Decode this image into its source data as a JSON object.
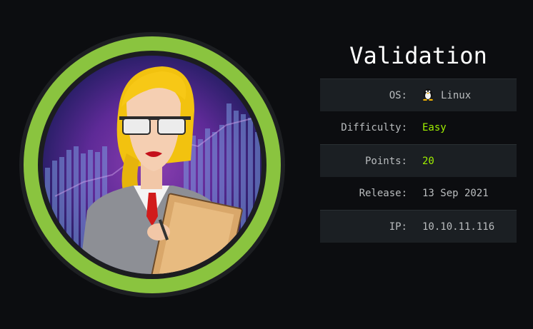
{
  "machine": {
    "name": "Validation",
    "rows": [
      {
        "label": "OS:",
        "value": "Linux",
        "icon": "linux-tux-icon"
      },
      {
        "label": "Difficulty:",
        "value": "Easy"
      },
      {
        "label": "Points:",
        "value": "20"
      },
      {
        "label": "Release:",
        "value": "13 Sep 2021"
      },
      {
        "label": "IP:",
        "value": "10.10.11.116"
      }
    ]
  },
  "colors": {
    "background": "#0c0d10",
    "ring": "#8ac43f",
    "accent_green": "#9fef00",
    "row_shade": "#1b1f23",
    "text": "#b9bcbe",
    "avatar_bg": "#5b2a8f"
  }
}
